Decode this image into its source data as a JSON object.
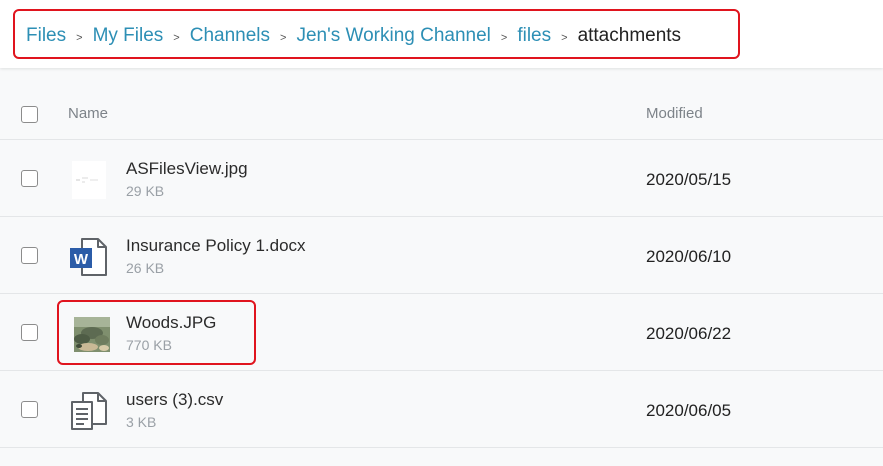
{
  "breadcrumb": {
    "items": [
      "Files",
      "My Files",
      "Channels",
      "Jen's Working Channel",
      "files"
    ],
    "current": "attachments",
    "separator": ">"
  },
  "table": {
    "columns": {
      "name": "Name",
      "modified": "Modified"
    },
    "rows": [
      {
        "name": "ASFilesView.jpg",
        "size": "29 KB",
        "modified": "2020/05/15",
        "icon": "image-thumbnail-icon"
      },
      {
        "name": "Insurance Policy 1.docx",
        "size": "26 KB",
        "modified": "2020/06/10",
        "icon": "word-document-icon"
      },
      {
        "name": "Woods.JPG",
        "size": "770 KB",
        "modified": "2020/06/22",
        "icon": "photo-thumbnail-icon"
      },
      {
        "name": "users (3).csv",
        "size": "3 KB",
        "modified": "2020/06/05",
        "icon": "csv-file-icon"
      }
    ]
  },
  "colors": {
    "link": "#2d8fb5",
    "highlight": "#e0141e",
    "word_blue": "#2b5ca8"
  }
}
